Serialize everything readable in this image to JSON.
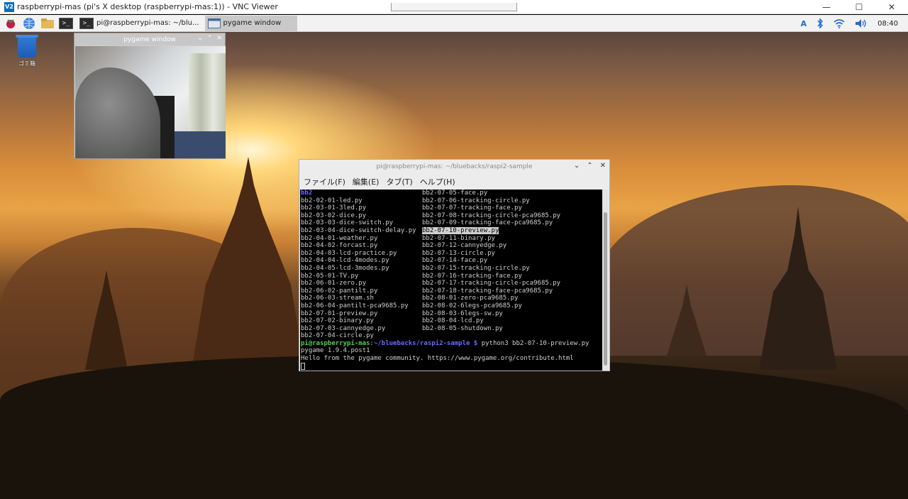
{
  "vnc": {
    "title": "raspberrypi-mas (pi's X desktop (raspberrypi-mas:1)) - VNC Viewer",
    "logo": "V2",
    "controls": [
      "—",
      "☐",
      "✕"
    ]
  },
  "panel": {
    "tasks": [
      {
        "label": "pi@raspberrypi-mas: ~/blu...",
        "icon": "terminal-icon"
      },
      {
        "label": "pygame window",
        "icon": "window-icon"
      }
    ],
    "tray": {
      "keyboard": "A",
      "time": "08:40"
    }
  },
  "desktop": {
    "trash_label": "ゴミ箱"
  },
  "pygame_window": {
    "title": "pygame window",
    "controls": [
      "⌄",
      "⌃",
      "✕"
    ]
  },
  "terminal": {
    "title": "pi@raspberrypi-mas: ~/bluebacks/raspi2-sample",
    "controls": [
      "⌄",
      "⌃",
      "✕"
    ],
    "menu": [
      "ファイル(F)",
      "編集(E)",
      "タブ(T)",
      "ヘルプ(H)"
    ],
    "ls_rows": [
      [
        "bb2",
        "bb2-07-05-face.py"
      ],
      [
        "bb2-02-01-led.py",
        "bb2-07-06-tracking-circle.py"
      ],
      [
        "bb2-03-01-3led.py",
        "bb2-07-07-tracking-face.py"
      ],
      [
        "bb2-03-02-dice.py",
        "bb2-07-08-tracking-circle-pca9685.py"
      ],
      [
        "bb2-03-03-dice-switch.py",
        "bb2-07-09-tracking-face-pca9685.py"
      ],
      [
        "bb2-03-04-dice-switch-delay.py",
        "bb2-07-10-preview.py"
      ],
      [
        "bb2-04-01-weather.py",
        "bb2-07-11-binary.py"
      ],
      [
        "bb2-04-02-forcast.py",
        "bb2-07-12-cannyedge.py"
      ],
      [
        "bb2-04-03-lcd-practice.py",
        "bb2-07-13-circle.py"
      ],
      [
        "bb2-04-04-lcd-4modes.py",
        "bb2-07-14-face.py"
      ],
      [
        "bb2-04-05-lcd-3modes.py",
        "bb2-07-15-tracking-circle.py"
      ],
      [
        "bb2-05-01-TV.py",
        "bb2-07-16-tracking-face.py"
      ],
      [
        "bb2-06-01-zero.py",
        "bb2-07-17-tracking-circle-pca9685.py"
      ],
      [
        "bb2-06-02-pantilt.py",
        "bb2-07-18-tracking-face-pca9685.py"
      ],
      [
        "bb2-06-03-stream.sh",
        "bb2-08-01-zero-pca9685.py"
      ],
      [
        "bb2-06-04-pantilt-pca9685.py",
        "bb2-08-02-6legs-pca9685.py"
      ],
      [
        "bb2-07-01-preview.py",
        "bb2-08-03-6legs-sw.py"
      ],
      [
        "bb2-07-02-binary.py",
        "bb2-08-04-lcd.py"
      ],
      [
        "bb2-07-03-cannyedge.py",
        "bb2-08-05-shutdown.py"
      ],
      [
        "bb2-07-04-circle.py",
        ""
      ]
    ],
    "prompt_user": "pi@raspberrypi-mas",
    "prompt_path": ":~/bluebacks/raspi2-sample $",
    "command": " python3 bb2-07-10-preview.py",
    "output": [
      "pygame 1.9.4.post1",
      "Hello from the pygame community. https://www.pygame.org/contribute.html"
    ]
  }
}
